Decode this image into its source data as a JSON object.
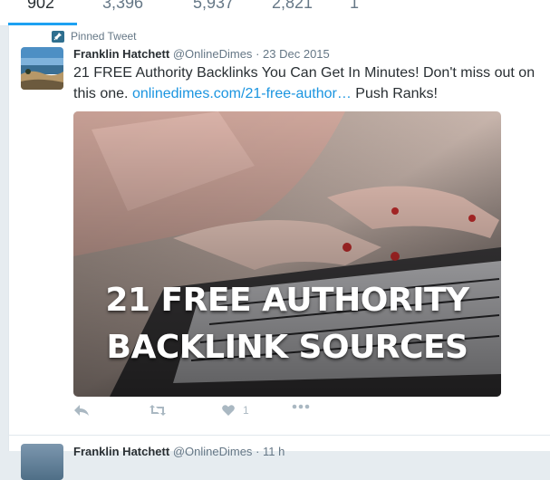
{
  "stats": [
    "902",
    "3,396",
    "5,937",
    "2,821",
    "1"
  ],
  "pinned_label": "Pinned Tweet",
  "tweet": {
    "author": "Franklin Hatchett",
    "handle": "@OnlineDimes",
    "separator": "·",
    "date": "23 Dec 2015",
    "text_before": "21 FREE Authority Backlinks You Can Get In Minutes! Don't miss out on this one. ",
    "link": "onlinedimes.com/21-free-author…",
    "text_after": " Push Ranks!",
    "media_caption_line1": "21 FREE AUTHORITY",
    "media_caption_line2": "BACKLINK SOURCES",
    "like_count": "1"
  },
  "icons": {
    "pin": "pin-icon",
    "reply": "reply-icon",
    "retweet": "retweet-icon",
    "like": "heart-icon",
    "more": "more-dots-icon"
  },
  "next_tweet": {
    "author": "Franklin Hatchett",
    "handle": "@OnlineDimes",
    "time": "11 h"
  },
  "colors": {
    "accent": "#1da1f2",
    "link": "#1b95e0",
    "muted": "#657786",
    "icon": "#aab8c2"
  }
}
